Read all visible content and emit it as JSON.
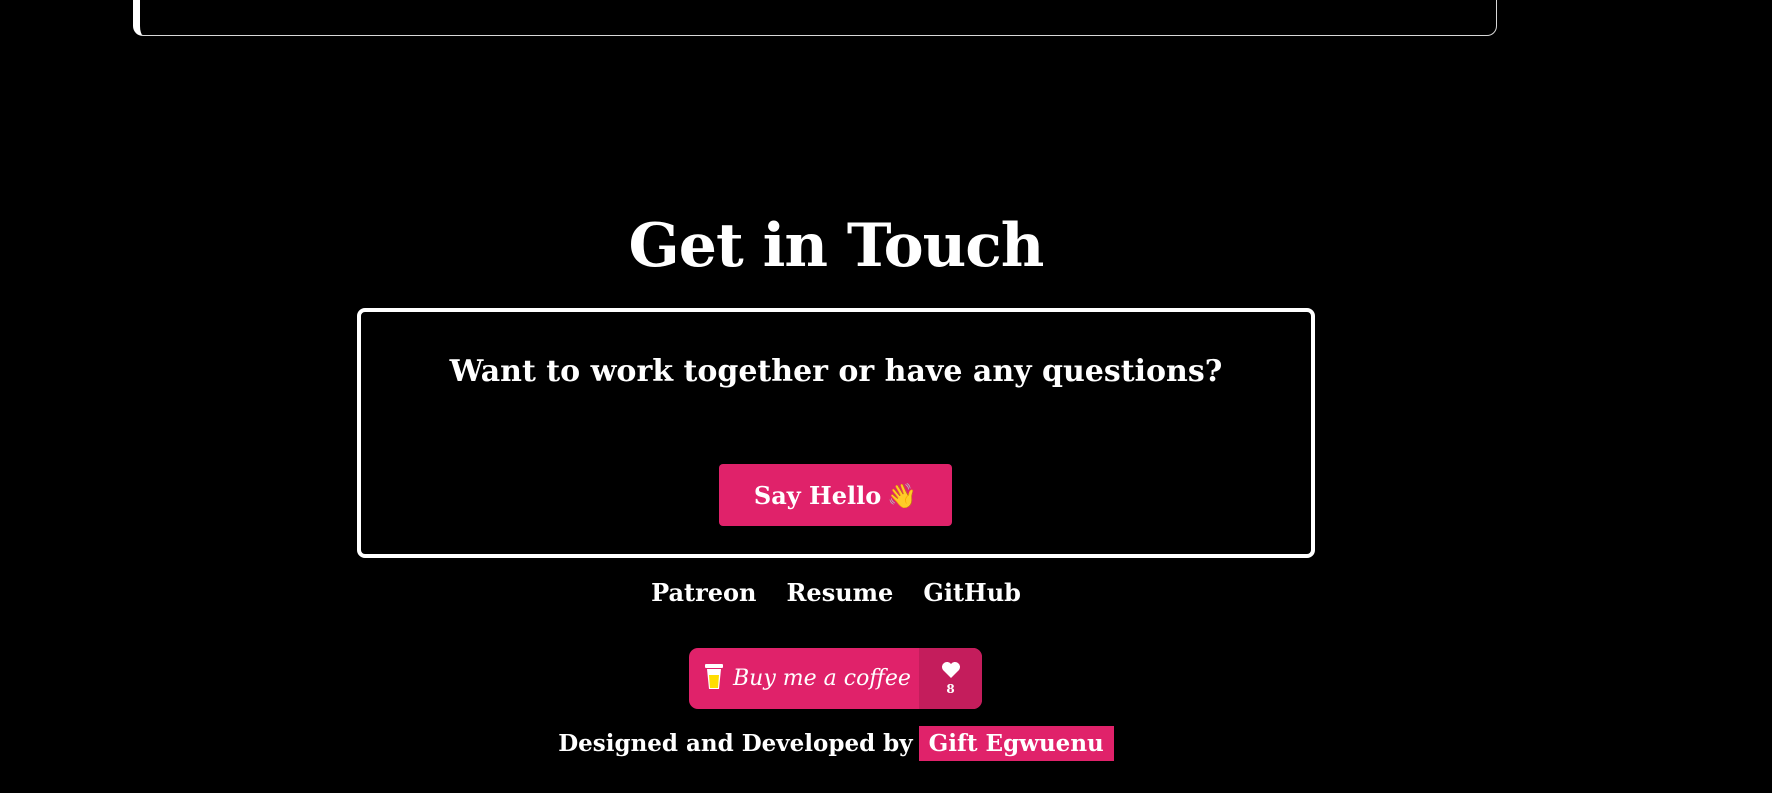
{
  "contact": {
    "heading": "Get in Touch",
    "question": "Want to work together or have any questions?",
    "button_label": "Say Hello",
    "button_emoji": "👋"
  },
  "links": [
    {
      "label": "Patreon"
    },
    {
      "label": "Resume"
    },
    {
      "label": "GitHub"
    }
  ],
  "coffee": {
    "label": "Buy me a coffee",
    "count": "8",
    "icons": [
      "coffee-cup-icon",
      "heart-icon"
    ]
  },
  "footer": {
    "credit_text": "Designed and Developed by",
    "author_name": "Gift Egwuenu"
  },
  "colors": {
    "background": "#000000",
    "accent": "#e0226a",
    "accent_dark": "#c41d5c",
    "text": "#ffffff"
  }
}
